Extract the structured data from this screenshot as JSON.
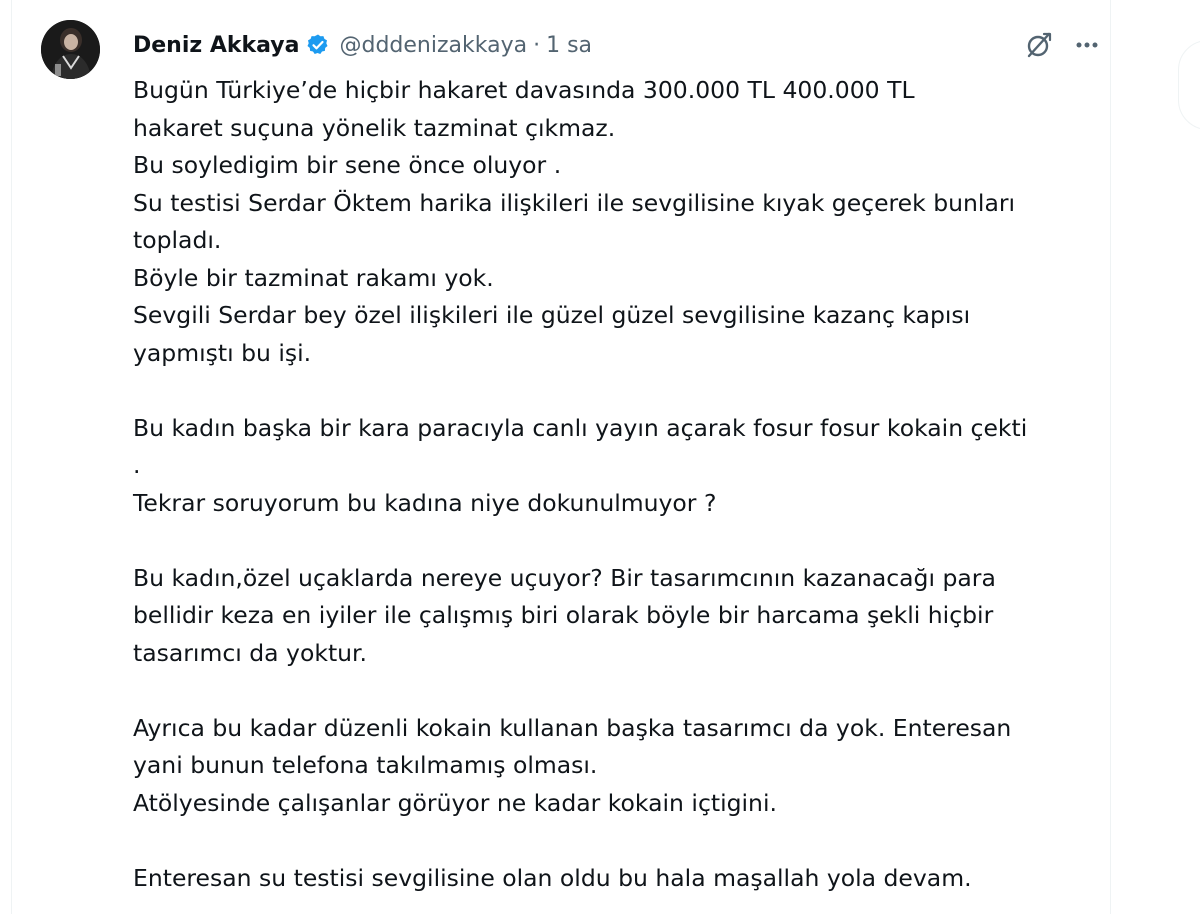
{
  "tweet": {
    "author": {
      "display_name": "Deniz Akkaya",
      "handle": "@dddenizakkaya",
      "verified": true,
      "avatar_icon": "profile-photo"
    },
    "separator": "·",
    "time": "1 sa",
    "actions": {
      "grok_icon": "grok-icon",
      "more_icon": "more-icon"
    },
    "text": "Bugün Türkiye’de hiçbir hakaret davasında 300.000 TL 400.000 TL\nhakaret suçuna yönelik tazminat çıkmaz.\nBu soyledigim bir sene önce oluyor .\nSu testisi Serdar Öktem harika ilişkileri ile sevgilisine kıyak geçerek bunları\ntopladı.\nBöyle bir tazminat rakamı yok.\nSevgili Serdar bey özel ilişkileri ile güzel güzel sevgilisine kazanç kapısı\nyapmıştı bu işi.\n\nBu kadın başka bir kara paracıyla canlı yayın açarak fosur fosur kokain çekti\n.\nTekrar soruyorum bu kadına niye dokunulmuyor ?\n\nBu kadın,özel uçaklarda nereye uçuyor? Bir tasarımcının kazanacağı para\nbellidir keza en iyiler ile çalışmış biri olarak böyle bir harcama şekli hiçbir\ntasarımcı da yoktur.\n\nAyrıca bu kadar düzenli kokain kullanan başka tasarımcı da yok. Enteresan\nyani bunun telefona takılmamış olması.\nAtölyesinde çalışanlar görüyor ne kadar kokain içtigini.\n\nEnteresan su testisi sevgilisine olan oldu bu hala maşallah yola devam."
  },
  "colors": {
    "text_primary": "#0f1419",
    "text_secondary": "#536471",
    "verified_blue": "#1d9bf0",
    "border": "#eff3f4"
  }
}
